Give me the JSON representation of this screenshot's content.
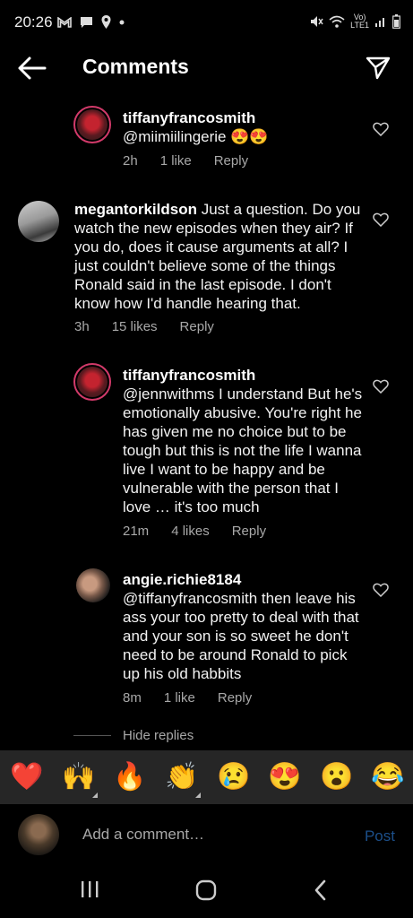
{
  "status_bar": {
    "time": "20:26",
    "lte": "Vo)\nLTE1",
    "icons": [
      "gmail-icon",
      "message-icon",
      "location-icon",
      "dot-icon",
      "mute-icon",
      "wifi-icon",
      "signal-icon",
      "battery-icon"
    ]
  },
  "header": {
    "title": "Comments"
  },
  "comments": [
    {
      "username": "tiffanyfrancosmith",
      "text": "@miimiilingerie 😍😍",
      "time": "2h",
      "likes": "1 like",
      "reply": "Reply"
    },
    {
      "username": "megantorkildson",
      "text": " Just a question. Do you watch the new episodes when they air? If you do, does it cause arguments at all? I just couldn't believe some of the things Ronald said in the last episode. I don't know how I'd handle hearing that.",
      "time": "3h",
      "likes": "15 likes",
      "reply": "Reply"
    },
    {
      "username": "tiffanyfrancosmith",
      "text": "@jennwithms I understand But he's emotionally abusive. You're right he has given me no choice but to be tough but this is not the life I wanna live I want to be happy and be vulnerable with the person that I love … it's too much",
      "time": "21m",
      "likes": "4 likes",
      "reply": "Reply"
    },
    {
      "username": "angie.richie8184",
      "text": "@tiffanyfrancosmith then leave his ass your too pretty to deal with that and your son is so sweet he don't need to be around Ronald to pick up his old habbits",
      "time": "8m",
      "likes": "1 like",
      "reply": "Reply"
    }
  ],
  "hide_replies": "Hide replies",
  "emoji_bar": [
    "❤️",
    "🙌",
    "🔥",
    "👏",
    "😢",
    "😍",
    "😮",
    "😂"
  ],
  "comment_input": {
    "placeholder": "Add a comment…",
    "post_label": "Post"
  },
  "colors": {
    "background": "#000000",
    "emoji_bar": "#262626",
    "meta_text": "#a8a8a8",
    "post_disabled": "#1c4f8a",
    "story_ring": "#d23a6a"
  }
}
